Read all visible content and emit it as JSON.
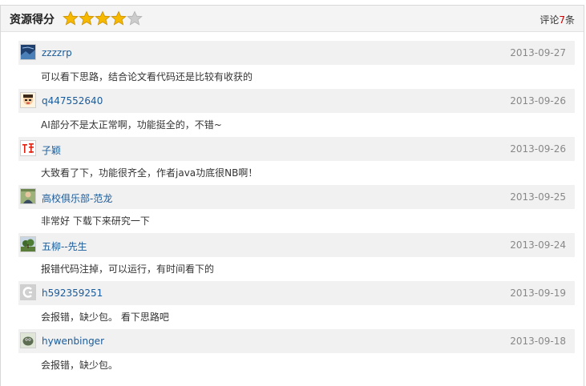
{
  "header": {
    "title": "资源得分",
    "rating": 4,
    "rating_max": 5,
    "count_prefix": "评论",
    "count_value": "7",
    "count_suffix": "条"
  },
  "comments": [
    {
      "user": "zzzzrp",
      "date": "2013-09-27",
      "text": "可以看下思路，结合论文看代码还是比较有收获的",
      "avatar": "dark-blue-photo"
    },
    {
      "user": "q447552640",
      "date": "2013-09-26",
      "text": "AI部分不是太正常啊，功能挺全的，不错~",
      "avatar": "cartoon-face"
    },
    {
      "user": "子颖",
      "date": "2013-09-26",
      "text": "大致看了下，功能很齐全，作者java功底很NB啊！",
      "avatar": "red-text-logo"
    },
    {
      "user": "高校俱乐部-范龙",
      "date": "2013-09-25",
      "text": "非常好  下载下来研究一下",
      "avatar": "portrait-photo"
    },
    {
      "user": "五柳--先生",
      "date": "2013-09-24",
      "text": "报错代码注掉，可以运行，有时间看下的",
      "avatar": "tree-landscape"
    },
    {
      "user": "h592359251",
      "date": "2013-09-19",
      "text": "会报错，缺少包。 看下思路吧",
      "avatar": "grey-logo"
    },
    {
      "user": "hywenbinger",
      "date": "2013-09-18",
      "text": "会报错，缺少包。",
      "avatar": "animal-photo"
    }
  ],
  "colors": {
    "star_filled": "#f7b800",
    "star_empty": "#cccccc",
    "link": "#1a5b9b",
    "count_accent": "#cc0000",
    "row_bg": "#f1f1f1"
  }
}
